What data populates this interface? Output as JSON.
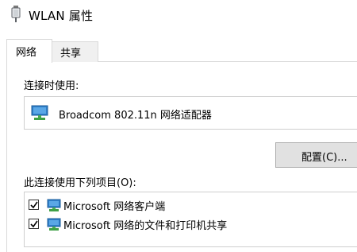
{
  "window": {
    "title": "WLAN 属性",
    "icon": "wlan-adapter-icon"
  },
  "tabs": [
    {
      "label": "网络",
      "active": true
    },
    {
      "label": "共享",
      "active": false
    }
  ],
  "connect_using": {
    "label": "连接时使用:",
    "adapter_name": "Broadcom 802.11n 网络适配器",
    "adapter_icon": "network-adapter-icon"
  },
  "configure_button": {
    "label": "配置(C)..."
  },
  "items_section": {
    "label": "此连接使用下列项目(O):",
    "items": [
      {
        "label": "Microsoft 网络客户端",
        "checked": true,
        "icon": "network-client-icon"
      },
      {
        "label": "Microsoft 网络的文件和打印机共享",
        "checked": true,
        "icon": "file-printer-sharing-icon"
      }
    ]
  }
}
